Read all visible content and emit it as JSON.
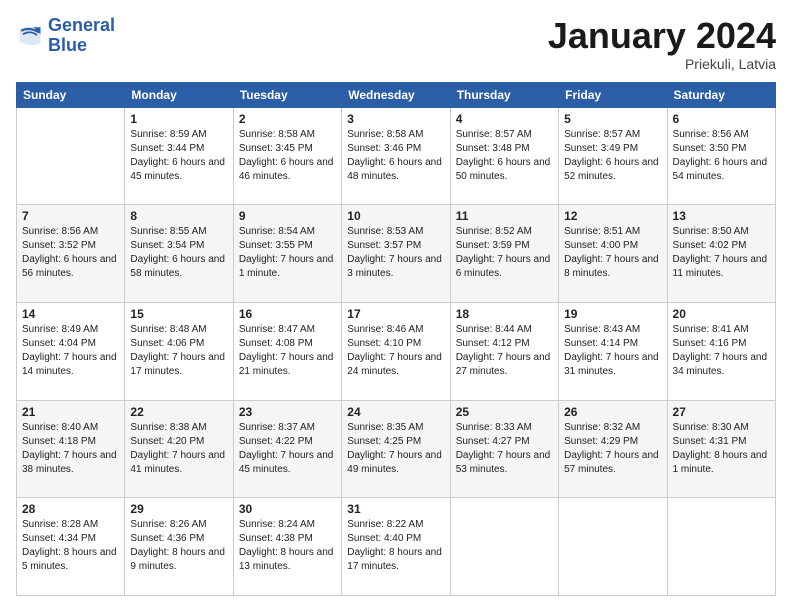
{
  "logo": {
    "line1": "General",
    "line2": "Blue"
  },
  "header": {
    "title": "January 2024",
    "location": "Priekuli, Latvia"
  },
  "days_of_week": [
    "Sunday",
    "Monday",
    "Tuesday",
    "Wednesday",
    "Thursday",
    "Friday",
    "Saturday"
  ],
  "weeks": [
    [
      {
        "day": "",
        "sunrise": "",
        "sunset": "",
        "daylight": ""
      },
      {
        "day": "1",
        "sunrise": "Sunrise: 8:59 AM",
        "sunset": "Sunset: 3:44 PM",
        "daylight": "Daylight: 6 hours and 45 minutes."
      },
      {
        "day": "2",
        "sunrise": "Sunrise: 8:58 AM",
        "sunset": "Sunset: 3:45 PM",
        "daylight": "Daylight: 6 hours and 46 minutes."
      },
      {
        "day": "3",
        "sunrise": "Sunrise: 8:58 AM",
        "sunset": "Sunset: 3:46 PM",
        "daylight": "Daylight: 6 hours and 48 minutes."
      },
      {
        "day": "4",
        "sunrise": "Sunrise: 8:57 AM",
        "sunset": "Sunset: 3:48 PM",
        "daylight": "Daylight: 6 hours and 50 minutes."
      },
      {
        "day": "5",
        "sunrise": "Sunrise: 8:57 AM",
        "sunset": "Sunset: 3:49 PM",
        "daylight": "Daylight: 6 hours and 52 minutes."
      },
      {
        "day": "6",
        "sunrise": "Sunrise: 8:56 AM",
        "sunset": "Sunset: 3:50 PM",
        "daylight": "Daylight: 6 hours and 54 minutes."
      }
    ],
    [
      {
        "day": "7",
        "sunrise": "Sunrise: 8:56 AM",
        "sunset": "Sunset: 3:52 PM",
        "daylight": "Daylight: 6 hours and 56 minutes."
      },
      {
        "day": "8",
        "sunrise": "Sunrise: 8:55 AM",
        "sunset": "Sunset: 3:54 PM",
        "daylight": "Daylight: 6 hours and 58 minutes."
      },
      {
        "day": "9",
        "sunrise": "Sunrise: 8:54 AM",
        "sunset": "Sunset: 3:55 PM",
        "daylight": "Daylight: 7 hours and 1 minute."
      },
      {
        "day": "10",
        "sunrise": "Sunrise: 8:53 AM",
        "sunset": "Sunset: 3:57 PM",
        "daylight": "Daylight: 7 hours and 3 minutes."
      },
      {
        "day": "11",
        "sunrise": "Sunrise: 8:52 AM",
        "sunset": "Sunset: 3:59 PM",
        "daylight": "Daylight: 7 hours and 6 minutes."
      },
      {
        "day": "12",
        "sunrise": "Sunrise: 8:51 AM",
        "sunset": "Sunset: 4:00 PM",
        "daylight": "Daylight: 7 hours and 8 minutes."
      },
      {
        "day": "13",
        "sunrise": "Sunrise: 8:50 AM",
        "sunset": "Sunset: 4:02 PM",
        "daylight": "Daylight: 7 hours and 11 minutes."
      }
    ],
    [
      {
        "day": "14",
        "sunrise": "Sunrise: 8:49 AM",
        "sunset": "Sunset: 4:04 PM",
        "daylight": "Daylight: 7 hours and 14 minutes."
      },
      {
        "day": "15",
        "sunrise": "Sunrise: 8:48 AM",
        "sunset": "Sunset: 4:06 PM",
        "daylight": "Daylight: 7 hours and 17 minutes."
      },
      {
        "day": "16",
        "sunrise": "Sunrise: 8:47 AM",
        "sunset": "Sunset: 4:08 PM",
        "daylight": "Daylight: 7 hours and 21 minutes."
      },
      {
        "day": "17",
        "sunrise": "Sunrise: 8:46 AM",
        "sunset": "Sunset: 4:10 PM",
        "daylight": "Daylight: 7 hours and 24 minutes."
      },
      {
        "day": "18",
        "sunrise": "Sunrise: 8:44 AM",
        "sunset": "Sunset: 4:12 PM",
        "daylight": "Daylight: 7 hours and 27 minutes."
      },
      {
        "day": "19",
        "sunrise": "Sunrise: 8:43 AM",
        "sunset": "Sunset: 4:14 PM",
        "daylight": "Daylight: 7 hours and 31 minutes."
      },
      {
        "day": "20",
        "sunrise": "Sunrise: 8:41 AM",
        "sunset": "Sunset: 4:16 PM",
        "daylight": "Daylight: 7 hours and 34 minutes."
      }
    ],
    [
      {
        "day": "21",
        "sunrise": "Sunrise: 8:40 AM",
        "sunset": "Sunset: 4:18 PM",
        "daylight": "Daylight: 7 hours and 38 minutes."
      },
      {
        "day": "22",
        "sunrise": "Sunrise: 8:38 AM",
        "sunset": "Sunset: 4:20 PM",
        "daylight": "Daylight: 7 hours and 41 minutes."
      },
      {
        "day": "23",
        "sunrise": "Sunrise: 8:37 AM",
        "sunset": "Sunset: 4:22 PM",
        "daylight": "Daylight: 7 hours and 45 minutes."
      },
      {
        "day": "24",
        "sunrise": "Sunrise: 8:35 AM",
        "sunset": "Sunset: 4:25 PM",
        "daylight": "Daylight: 7 hours and 49 minutes."
      },
      {
        "day": "25",
        "sunrise": "Sunrise: 8:33 AM",
        "sunset": "Sunset: 4:27 PM",
        "daylight": "Daylight: 7 hours and 53 minutes."
      },
      {
        "day": "26",
        "sunrise": "Sunrise: 8:32 AM",
        "sunset": "Sunset: 4:29 PM",
        "daylight": "Daylight: 7 hours and 57 minutes."
      },
      {
        "day": "27",
        "sunrise": "Sunrise: 8:30 AM",
        "sunset": "Sunset: 4:31 PM",
        "daylight": "Daylight: 8 hours and 1 minute."
      }
    ],
    [
      {
        "day": "28",
        "sunrise": "Sunrise: 8:28 AM",
        "sunset": "Sunset: 4:34 PM",
        "daylight": "Daylight: 8 hours and 5 minutes."
      },
      {
        "day": "29",
        "sunrise": "Sunrise: 8:26 AM",
        "sunset": "Sunset: 4:36 PM",
        "daylight": "Daylight: 8 hours and 9 minutes."
      },
      {
        "day": "30",
        "sunrise": "Sunrise: 8:24 AM",
        "sunset": "Sunset: 4:38 PM",
        "daylight": "Daylight: 8 hours and 13 minutes."
      },
      {
        "day": "31",
        "sunrise": "Sunrise: 8:22 AM",
        "sunset": "Sunset: 4:40 PM",
        "daylight": "Daylight: 8 hours and 17 minutes."
      },
      {
        "day": "",
        "sunrise": "",
        "sunset": "",
        "daylight": ""
      },
      {
        "day": "",
        "sunrise": "",
        "sunset": "",
        "daylight": ""
      },
      {
        "day": "",
        "sunrise": "",
        "sunset": "",
        "daylight": ""
      }
    ]
  ]
}
